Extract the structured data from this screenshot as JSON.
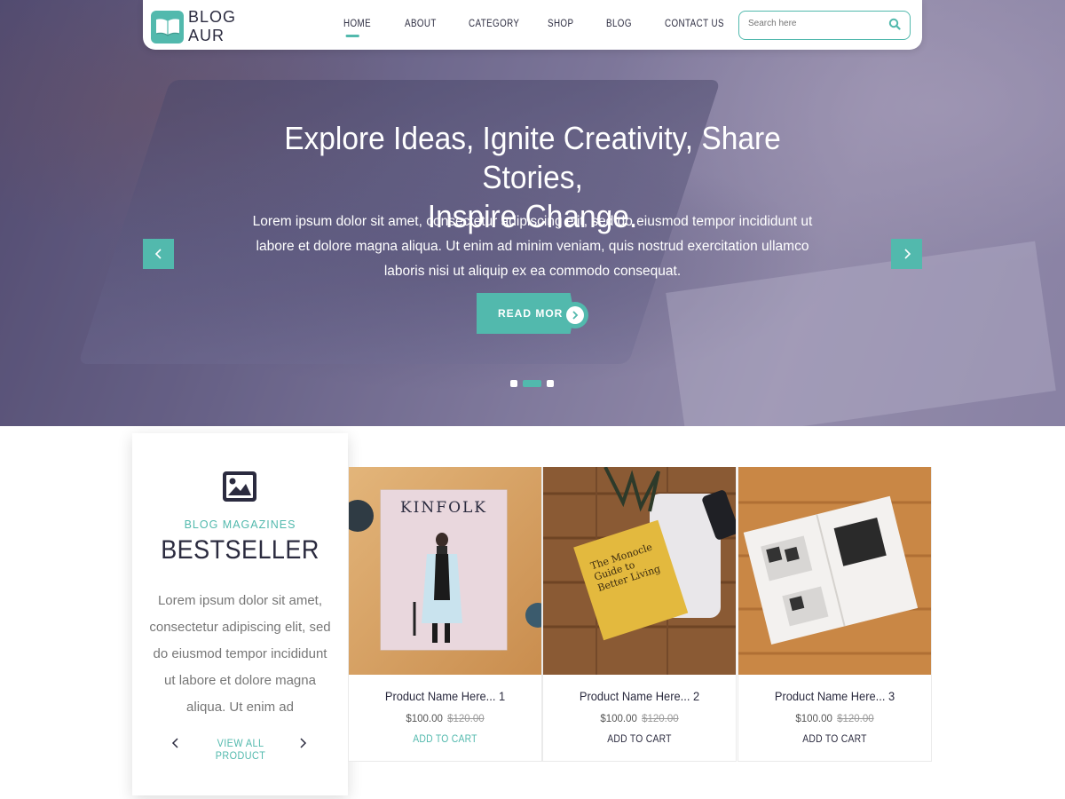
{
  "brand": {
    "logo_line1": "BLOG",
    "logo_line2": "AUR",
    "accent": "#52b9ad"
  },
  "nav": {
    "items": [
      {
        "label": "HOME",
        "active": true
      },
      {
        "label": "ABOUT"
      },
      {
        "label": "CATEGORY"
      },
      {
        "label": "SHOP"
      },
      {
        "label": "BLOG"
      },
      {
        "label": "CONTACT US"
      }
    ],
    "search_placeholder": "Search here",
    "search_icon": "search-icon"
  },
  "hero": {
    "title_line1": "Explore Ideas, Ignite Creativity, Share Stories,",
    "title_line2": "Inspire Change.",
    "text": "Lorem ipsum dolor sit amet, consectetur adipiscing elit, sed do eiusmod tempor incididunt ut labore et dolore magna aliqua. Ut enim ad minim veniam, quis nostrud exercitation ullamco laboris nisi ut aliquip ex ea commodo consequat.",
    "button_label": "READ MORE",
    "slide_count": 3,
    "active_slide": 2
  },
  "bestseller": {
    "icon": "image-icon",
    "eyebrow": "BLOG MAGAZINES",
    "title": "BESTSELLER",
    "text": "Lorem ipsum dolor sit amet, consectetur adipiscing elit, sed do eiusmod tempor incididunt ut labore et dolore magna aliqua. Ut enim ad",
    "link_label": "VIEW ALL PRODUCT"
  },
  "products": [
    {
      "name": "Product Name Here... 1",
      "price": "$100.00",
      "old_price": "$120.00",
      "cart_label": "ADD TO CART",
      "image_text": "KINFOLK"
    },
    {
      "name": "Product Name Here... 2",
      "price": "$100.00",
      "old_price": "$120.00",
      "cart_label": "ADD TO CART",
      "image_text": "The Monocle Guide to Better Living"
    },
    {
      "name": "Product Name Here... 3",
      "price": "$100.00",
      "old_price": "$120.00",
      "cart_label": "ADD TO CART"
    }
  ]
}
